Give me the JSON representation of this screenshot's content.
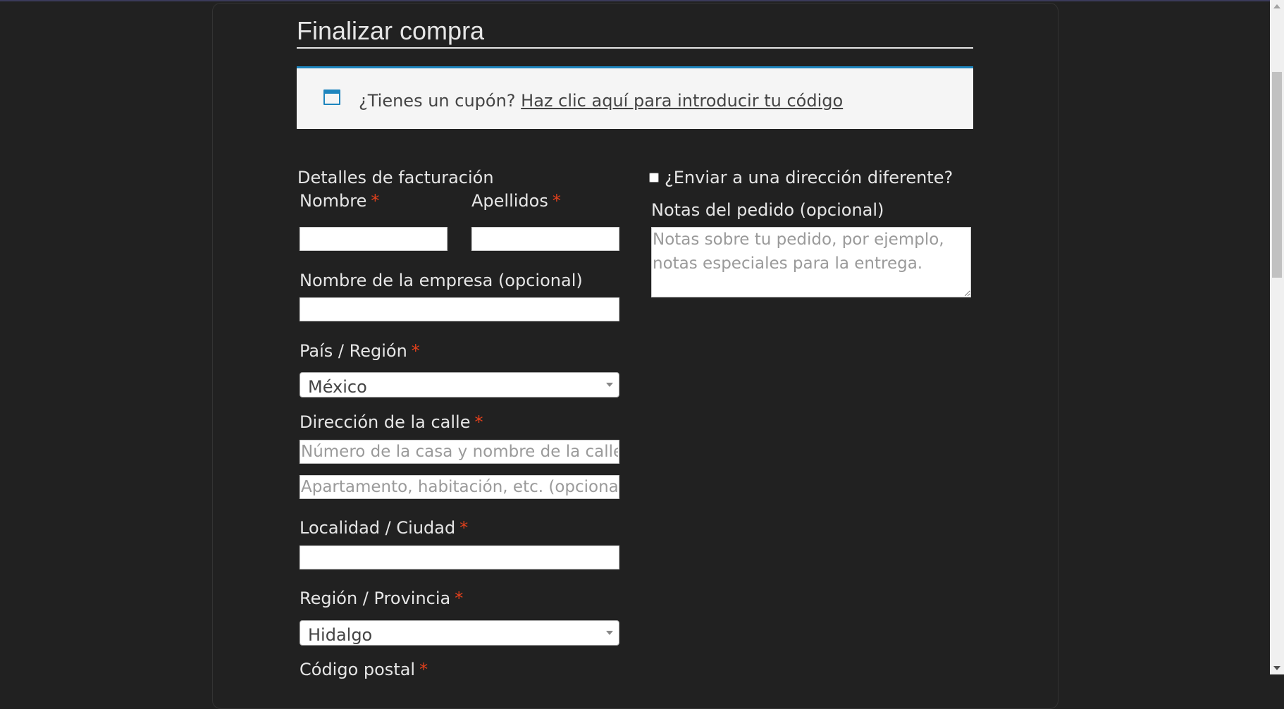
{
  "page": {
    "title": "Finalizar compra"
  },
  "coupon": {
    "question": "¿Tienes un cupón?",
    "link_text": "Haz clic aquí para introducir tu código"
  },
  "billing": {
    "section_title": "Detalles de facturación",
    "required_mark": "*",
    "first_name_label": "Nombre",
    "last_name_label": "Apellidos",
    "company_label": "Nombre de la empresa (opcional)",
    "country_label": "País / Región",
    "country_value": "México",
    "street_label": "Dirección de la calle",
    "street1_placeholder": "Número de la casa y nombre de la calle",
    "street2_placeholder": "Apartamento, habitación, etc. (opcional)",
    "city_label": "Localidad / Ciudad",
    "state_label": "Región / Provincia",
    "state_value": "Hidalgo",
    "postcode_label": "Código postal"
  },
  "shipping": {
    "ship_different_label": "¿Enviar a una dirección diferente?",
    "ship_different_checked": false,
    "notes_label": "Notas del pedido (opcional)",
    "notes_placeholder": "Notas sobre tu pedido, por ejemplo, notas especiales para la entrega."
  },
  "colors": {
    "background": "#212121",
    "text": "#e6e6e6",
    "accent": "#1e85be",
    "required": "#e2401c",
    "coupon_bg": "#f5f5f5"
  },
  "scrollbar": {
    "position_fraction": 0.12
  }
}
